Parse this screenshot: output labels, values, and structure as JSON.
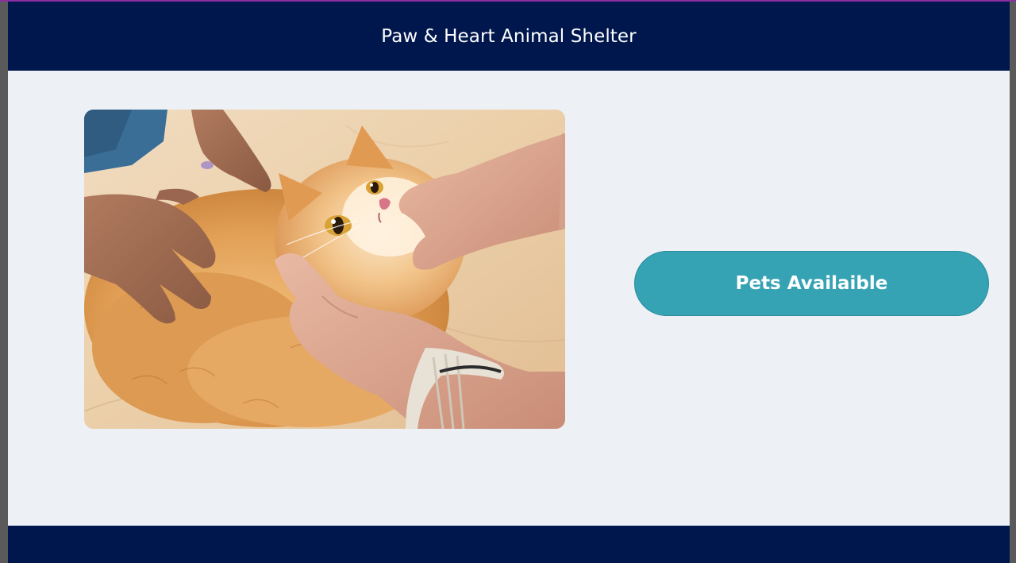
{
  "header": {
    "title": "Paw & Heart Animal Shelter"
  },
  "main": {
    "photo_subject": "cat-being-petted-photo",
    "pets_button_label": "Pets Availaible"
  },
  "colors": {
    "header_bg": "#00174d",
    "page_bg": "#edf1f5",
    "button_bg": "#35a3b4",
    "footer_bg": "#00174d"
  }
}
